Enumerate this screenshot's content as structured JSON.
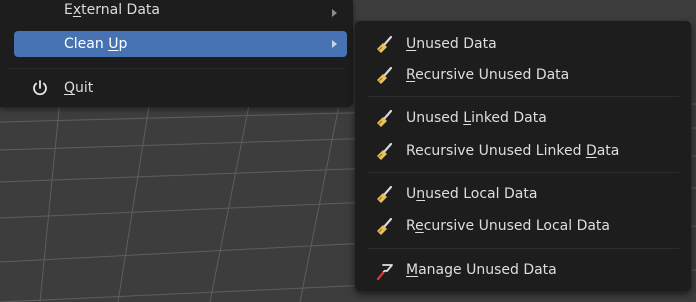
{
  "file_menu": {
    "items": [
      {
        "pre": "E",
        "key": "x",
        "post": "ternal Data",
        "has_submenu": true
      },
      {
        "pre": "Clean ",
        "key": "U",
        "post": "p",
        "has_submenu": true,
        "active": true
      },
      {
        "pre": "",
        "key": "Q",
        "post": "uit",
        "icon": "power-icon"
      }
    ]
  },
  "cleanup_menu": {
    "icon_broom": "broom-icon",
    "icon_orphan": "orphan-data-icon",
    "items": [
      {
        "pre": "",
        "key": "U",
        "post": "nused Data"
      },
      {
        "pre": "",
        "key": "R",
        "post": "ecursive Unused Data"
      },
      {
        "pre": "Unused ",
        "key": "L",
        "post": "inked Data"
      },
      {
        "pre": "Recursive Unused Linked ",
        "key": "D",
        "post": "ata"
      },
      {
        "pre": "U",
        "key": "n",
        "post": "used Local Data"
      },
      {
        "pre": "R",
        "key": "e",
        "post": "cursive Unused Local Data"
      },
      {
        "pre": "",
        "key": "M",
        "post": "anage Unused Data"
      }
    ]
  },
  "colors": {
    "menu_bg": "#1d1d1d",
    "active_bg": "#4772b3",
    "text": "#dcdcdc",
    "viewport_bg": "#3d3d3d",
    "grid": "#5c5c5c"
  }
}
